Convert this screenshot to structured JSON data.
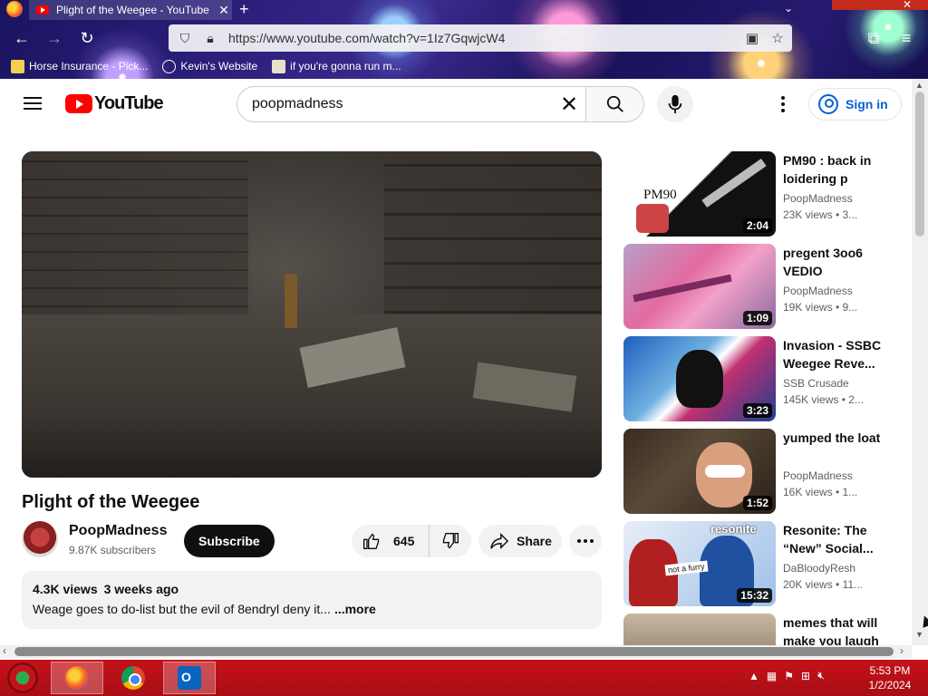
{
  "browser": {
    "tab_title": "Plight of the Weegee - YouTube",
    "url": "https://www.youtube.com/watch?v=1Iz7GqwjcW4",
    "bookmarks": [
      {
        "label": "Horse Insurance - Pick...",
        "icon": "horse-icon"
      },
      {
        "label": "Kevin's Website",
        "icon": "globe-icon"
      },
      {
        "label": "if you're gonna run m...",
        "icon": "page-icon"
      }
    ]
  },
  "masthead": {
    "logo_text": "YouTube",
    "search_value": "poopmadness",
    "signin_label": "Sign in"
  },
  "video": {
    "title": "Plight of the Weegee",
    "channel": "PoopMadness",
    "subscribers": "9.87K subscribers",
    "subscribe_label": "Subscribe",
    "likes": "645",
    "share_label": "Share",
    "views": "4.3K views",
    "age": "3 weeks ago",
    "description": "Weage goes to do-list but the evil of 8endryl deny it...",
    "more_label": "...more"
  },
  "recommendations": [
    {
      "title": "PM90 : back in loidering p",
      "channel": "PoopMadness",
      "stats": "23K views • 3...",
      "duration": "2:04",
      "thumb_text": "PM90"
    },
    {
      "title": "pregent 3oo6 VEDIO",
      "channel": "PoopMadness",
      "stats": "19K views • 9...",
      "duration": "1:09"
    },
    {
      "title": "Invasion - SSBC Weegee Reve...",
      "channel": "SSB Crusade",
      "stats": "145K views • 2...",
      "duration": "3:23"
    },
    {
      "title": "yumped the loat",
      "channel": "PoopMadness",
      "stats": "16K views • 1...",
      "duration": "1:52"
    },
    {
      "title": "Resonite: The “New” Social...",
      "channel": "DaBloodyResh",
      "stats": "20K views • 11...",
      "duration": "15:32",
      "thumb_brand": "resonite",
      "thumb_label": "not a furry"
    },
    {
      "title": "memes that will make you laugh",
      "channel": "",
      "stats": "",
      "duration": ""
    }
  ],
  "taskbar": {
    "time": "5:53 PM",
    "date": "1/2/2024"
  }
}
